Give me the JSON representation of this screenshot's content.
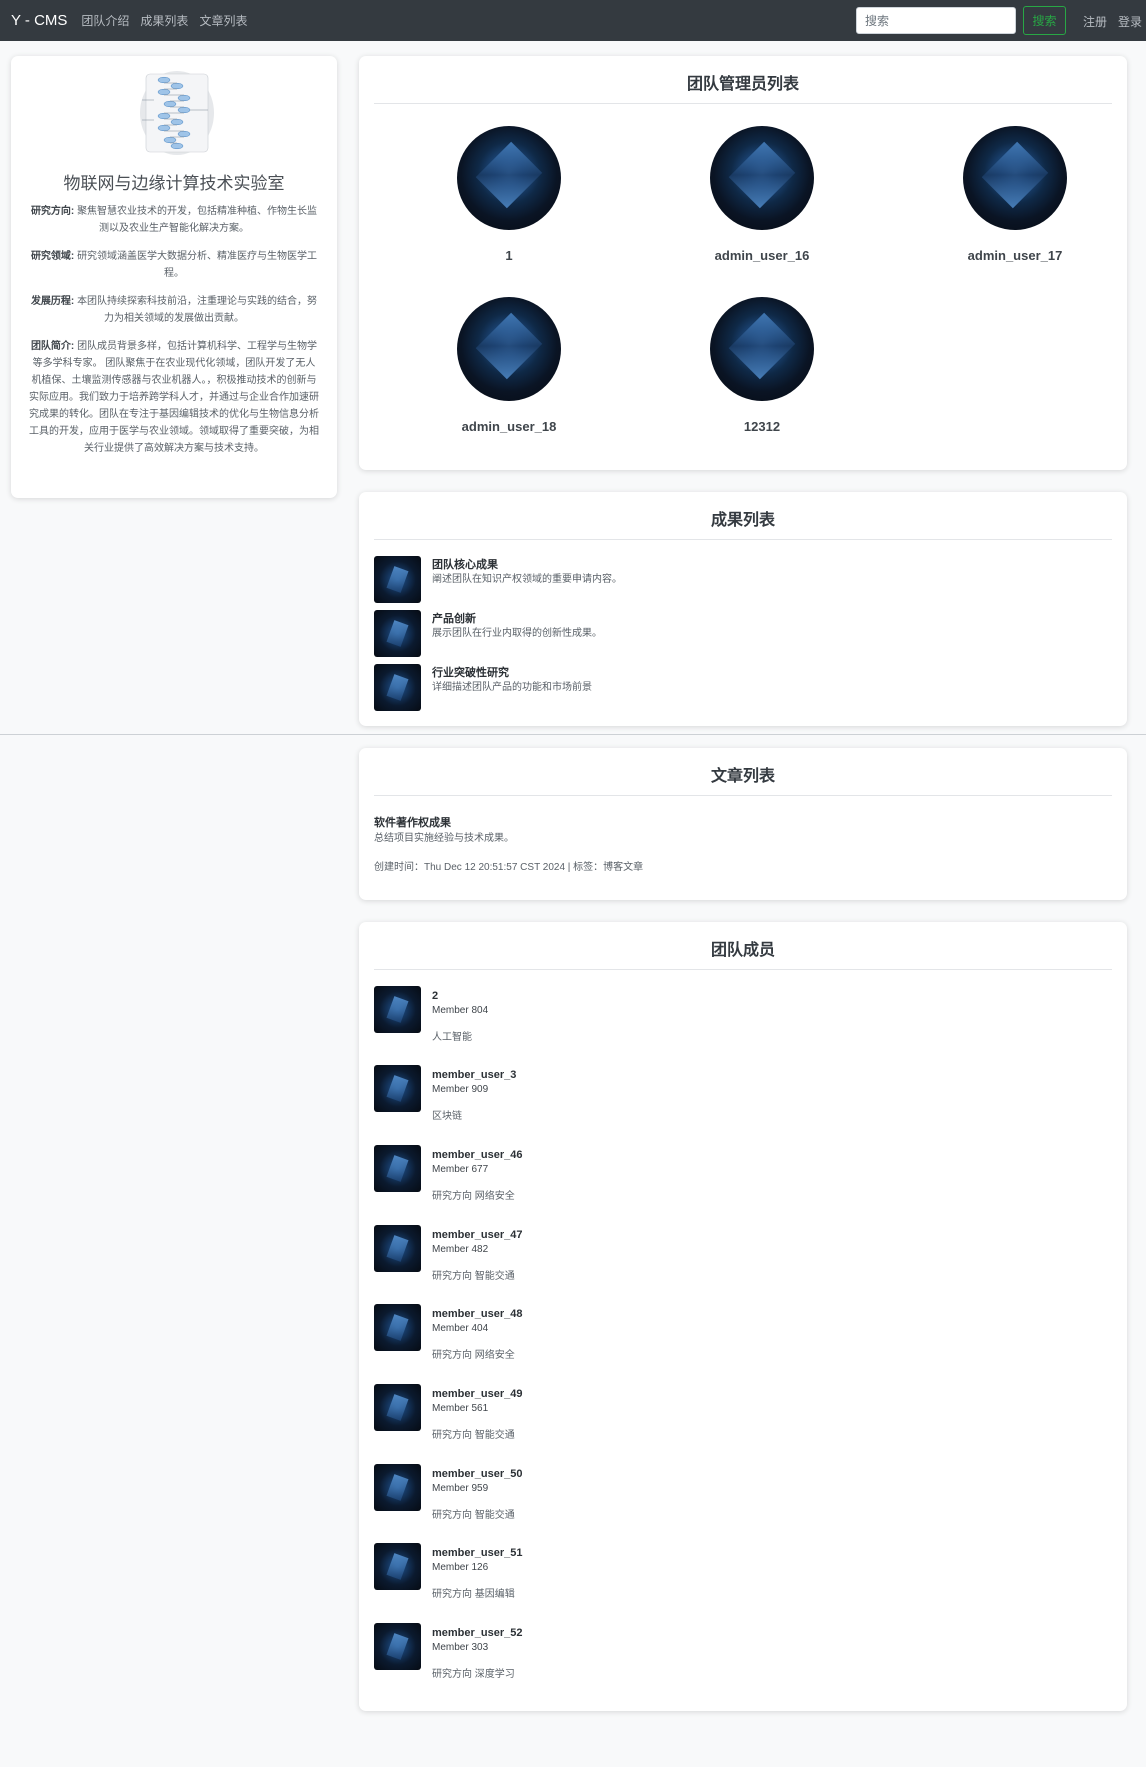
{
  "navbar": {
    "brand": "Y - CMS",
    "links": [
      "团队介绍",
      "成果列表",
      "文章列表"
    ],
    "search_placeholder": "搜索",
    "search_button": "搜索",
    "register": "注册",
    "login": "登录"
  },
  "profile": {
    "team_name": "物联网与边缘计算技术实验室",
    "research_direction_label": "研究方向:",
    "research_direction": "聚焦智慧农业技术的开发，包括精准种植、作物生长监测以及农业生产智能化解决方案。",
    "research_field_label": "研究领域:",
    "research_field": "研究领域涵盖医学大数据分析、精准医疗与生物医学工程。",
    "history_label": "发展历程:",
    "history": "本团队持续探索科技前沿，注重理论与实践的结合，努力为相关领域的发展做出贡献。",
    "intro_label": "团队简介:",
    "intro": "团队成员背景多样，包括计算机科学、工程学与生物学等多学科专家。 团队聚焦于在农业现代化领域，团队开发了无人机植保、土壤监测传感器与农业机器人。，积极推动技术的创新与实际应用。我们致力于培养跨学科人才，并通过与企业合作加速研究成果的转化。团队在专注于基因编辑技术的优化与生物信息分析工具的开发，应用于医学与农业领域。领域取得了重要突破，为相关行业提供了高效解决方案与技术支持。"
  },
  "admins": {
    "title": "团队管理员列表",
    "items": [
      {
        "name": "1"
      },
      {
        "name": "admin_user_16"
      },
      {
        "name": "admin_user_17"
      },
      {
        "name": "admin_user_18"
      },
      {
        "name": "12312"
      }
    ]
  },
  "achievements": {
    "title": "成果列表",
    "items": [
      {
        "title": "团队核心成果",
        "desc": "阐述团队在知识产权领域的重要申请内容。"
      },
      {
        "title": "产品创新",
        "desc": "展示团队在行业内取得的创新性成果。"
      },
      {
        "title": "行业突破性研究",
        "desc": "详细描述团队产品的功能和市场前景"
      }
    ]
  },
  "articles": {
    "title": "文章列表",
    "items": [
      {
        "title": "软件著作权成果",
        "desc": "总结项目实施经验与技术成果。",
        "meta": "创建时间：Thu Dec 12 20:51:57 CST 2024 | 标签：博客文章"
      }
    ]
  },
  "members": {
    "title": "团队成员",
    "items": [
      {
        "name": "2",
        "role": "Member 804",
        "field": "人工智能"
      },
      {
        "name": "member_user_3",
        "role": "Member 909",
        "field": "区块链"
      },
      {
        "name": "member_user_46",
        "role": "Member 677",
        "field": "研究方向 网络安全"
      },
      {
        "name": "member_user_47",
        "role": "Member 482",
        "field": "研究方向 智能交通"
      },
      {
        "name": "member_user_48",
        "role": "Member 404",
        "field": "研究方向 网络安全"
      },
      {
        "name": "member_user_49",
        "role": "Member 561",
        "field": "研究方向 智能交通"
      },
      {
        "name": "member_user_50",
        "role": "Member 959",
        "field": "研究方向 智能交通"
      },
      {
        "name": "member_user_51",
        "role": "Member 126",
        "field": "研究方向 基因编辑"
      },
      {
        "name": "member_user_52",
        "role": "Member 303",
        "field": "研究方向 深度学习"
      }
    ]
  }
}
